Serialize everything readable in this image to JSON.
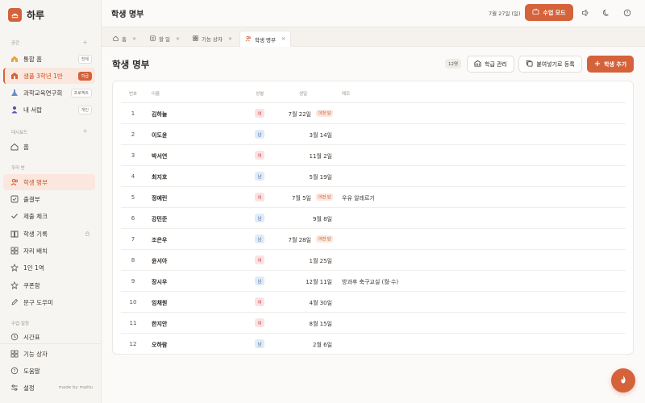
{
  "app": {
    "name": "하루"
  },
  "sidebar": {
    "section_space": "공간",
    "spaces": [
      {
        "label": "통합 홈",
        "badge": "전체"
      },
      {
        "label": "샘플 3학년 1반",
        "badge": "학급"
      },
      {
        "label": "과학교육연구회",
        "badge": "프로젝트"
      },
      {
        "label": "내 서랍",
        "badge": "개인"
      }
    ],
    "section_dashboard": "대시보드",
    "home": "홈",
    "section_class": "우리 반",
    "class_items": [
      {
        "label": "학생 명부",
        "icon": "users-icon"
      },
      {
        "label": "출결부",
        "icon": "checkbox-icon"
      },
      {
        "label": "제출 체크",
        "icon": "check-icon"
      },
      {
        "label": "학생 기록",
        "icon": "book-icon"
      },
      {
        "label": "자리 배치",
        "icon": "grid-icon"
      },
      {
        "label": "1인 1역",
        "icon": "star-icon"
      },
      {
        "label": "쿠폰함",
        "icon": "star-icon"
      },
      {
        "label": "문구 도우미",
        "icon": "pencil-icon"
      }
    ],
    "section_schedule": "수업·일정",
    "schedule_items": [
      {
        "label": "시간표"
      }
    ],
    "bottom_items": [
      {
        "label": "기능 상자"
      },
      {
        "label": "도움말"
      },
      {
        "label": "설정"
      }
    ],
    "made_by": "made by mattu"
  },
  "topbar": {
    "title": "학생 명부",
    "date": "7월 27일 (일)",
    "class_mode": "수업 모드"
  },
  "tabs": [
    {
      "label": "홈"
    },
    {
      "label": "할 일"
    },
    {
      "label": "기능 상자"
    },
    {
      "label": "학생 명부"
    }
  ],
  "main": {
    "title": "학생 명부",
    "count": "12명",
    "btn_manage": "학급 관리",
    "btn_paste": "붙여넣기로 등록",
    "btn_add": "학생 추가"
  },
  "table": {
    "headers": [
      "번호",
      "이름",
      "성별",
      "생일",
      "메모"
    ],
    "birthday_badge": "이번 달",
    "rows": [
      {
        "num": "1",
        "name": "김하늘",
        "gender": "여",
        "bday": "7월 22일",
        "this_month": true,
        "memo": ""
      },
      {
        "num": "2",
        "name": "이도윤",
        "gender": "남",
        "bday": "3월 14일",
        "this_month": false,
        "memo": ""
      },
      {
        "num": "3",
        "name": "박서연",
        "gender": "여",
        "bday": "11월 2일",
        "this_month": false,
        "memo": ""
      },
      {
        "num": "4",
        "name": "최지호",
        "gender": "남",
        "bday": "5월 19일",
        "this_month": false,
        "memo": ""
      },
      {
        "num": "5",
        "name": "정예린",
        "gender": "여",
        "bday": "7월 5일",
        "this_month": true,
        "memo": "우유 알레르기"
      },
      {
        "num": "6",
        "name": "강민준",
        "gender": "남",
        "bday": "9월 8일",
        "this_month": false,
        "memo": ""
      },
      {
        "num": "7",
        "name": "조은우",
        "gender": "남",
        "bday": "7월 28일",
        "this_month": true,
        "memo": ""
      },
      {
        "num": "8",
        "name": "윤서아",
        "gender": "여",
        "bday": "1월 25일",
        "this_month": false,
        "memo": ""
      },
      {
        "num": "9",
        "name": "장시우",
        "gender": "남",
        "bday": "12월 11일",
        "this_month": false,
        "memo": "방과후 축구교실 (월·수)"
      },
      {
        "num": "10",
        "name": "임채원",
        "gender": "여",
        "bday": "4월 30일",
        "this_month": false,
        "memo": ""
      },
      {
        "num": "11",
        "name": "한지안",
        "gender": "여",
        "bday": "8월 15일",
        "this_month": false,
        "memo": ""
      },
      {
        "num": "12",
        "name": "오하람",
        "gender": "남",
        "bday": "2월 6일",
        "this_month": false,
        "memo": ""
      }
    ]
  },
  "colors": {
    "accent": "#d4623a",
    "female": "#c0464a",
    "male": "#3c6a9c"
  }
}
